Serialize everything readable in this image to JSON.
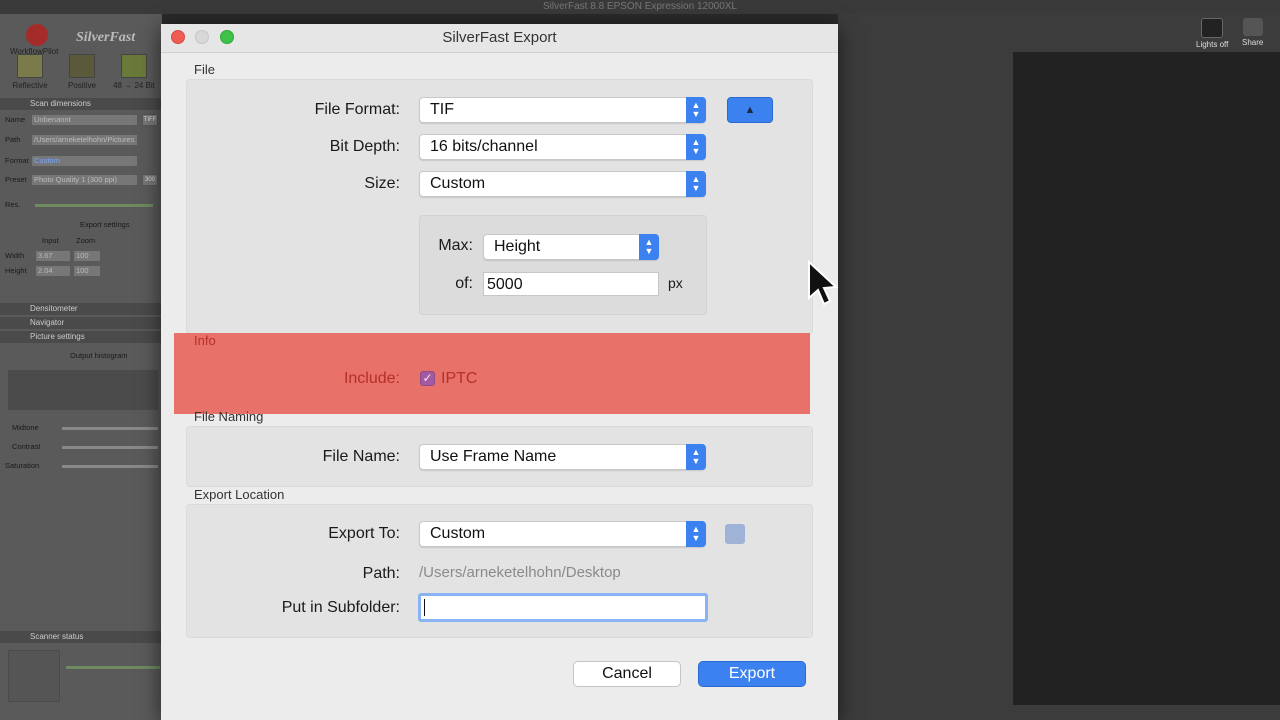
{
  "background_app": {
    "window_title": "SilverFast 8.8 EPSON Expression 12000XL",
    "brand": "SilverFast",
    "workflow_label": "WorkflowPilot",
    "tools": [
      "Reflective",
      "Positive",
      "48 → 24 Bit"
    ],
    "panels": {
      "scan_dimensions": "Scan dimensions",
      "name_label": "Name",
      "name_value": "Unbenannt",
      "name_format": "TIFF",
      "path_label": "Path",
      "path_value": "/Users/arneketelhohn/Pictures",
      "format_label": "Format",
      "format_value": "Custom",
      "preset_label": "Preset",
      "preset_value": "Photo Quality 1 (300 ppi)",
      "preset_num": "300",
      "res_label": "Res.",
      "export_settings": "Export settings",
      "input_label": "Input",
      "zoom_label": "Zoom",
      "width_label": "Width",
      "width_value": "3.67",
      "width_zoom": "100",
      "height_label": "Height",
      "height_value": "2.04",
      "height_zoom": "100",
      "densitometer": "Densitometer",
      "navigator": "Navigator",
      "picture_settings": "Picture settings",
      "output_histogram": "Output histogram",
      "midtone": "Midtone",
      "contrast": "Contrast",
      "saturation": "Saturation",
      "scanner_status": "Scanner status"
    },
    "right_icons": [
      "Lights off",
      "Share"
    ]
  },
  "dialog": {
    "title": "SilverFast Export",
    "file_section": {
      "label": "File",
      "file_format_label": "File Format:",
      "file_format_value": "TIF",
      "bit_depth_label": "Bit Depth:",
      "bit_depth_value": "16 bits/channel",
      "size_label": "Size:",
      "size_value": "Custom",
      "max_label": "Max:",
      "max_value": "Height",
      "of_label": "of:",
      "of_value": "5000",
      "unit": "px"
    },
    "info_section": {
      "label": "Info",
      "include_label": "Include:",
      "iptc_label": "IPTC",
      "iptc_checked": true,
      "highlight_color": "#e8716a"
    },
    "naming_section": {
      "label": "File Naming",
      "file_name_label": "File Name:",
      "file_name_value": "Use Frame Name"
    },
    "location_section": {
      "label": "Export Location",
      "export_to_label": "Export To:",
      "export_to_value": "Custom",
      "path_label": "Path:",
      "path_value": "/Users/arneketelhohn/Desktop",
      "subfolder_label": "Put in Subfolder:",
      "subfolder_value": ""
    },
    "buttons": {
      "cancel": "Cancel",
      "export": "Export"
    },
    "accent_color": "#3b82f0"
  }
}
